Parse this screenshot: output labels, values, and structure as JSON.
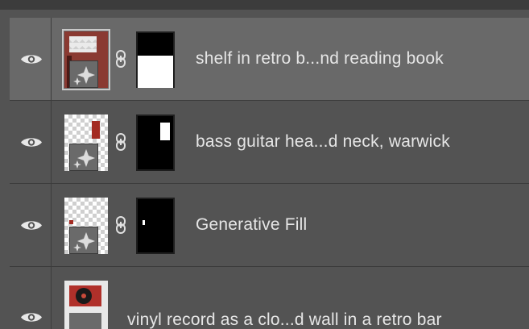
{
  "layers": [
    {
      "name": "shelf in retro b...nd reading book",
      "selected": true,
      "visible": true,
      "has_mask": true,
      "linked": true
    },
    {
      "name": "bass guitar hea...d neck, warwick",
      "selected": false,
      "visible": true,
      "has_mask": true,
      "linked": true
    },
    {
      "name": "Generative Fill",
      "selected": false,
      "visible": true,
      "has_mask": true,
      "linked": true
    },
    {
      "name": "vinyl record as a clo...d wall in a retro bar",
      "selected": false,
      "visible": true,
      "has_mask": false,
      "linked": false
    }
  ],
  "icons": {
    "visibility": "eye-icon",
    "link": "chain-link-icon",
    "generative": "sparkle-icon"
  },
  "colors": {
    "panel_bg": "#535353",
    "selected_bg": "#696969",
    "separator": "#3c3c3c",
    "text": "#e6e6e6"
  }
}
